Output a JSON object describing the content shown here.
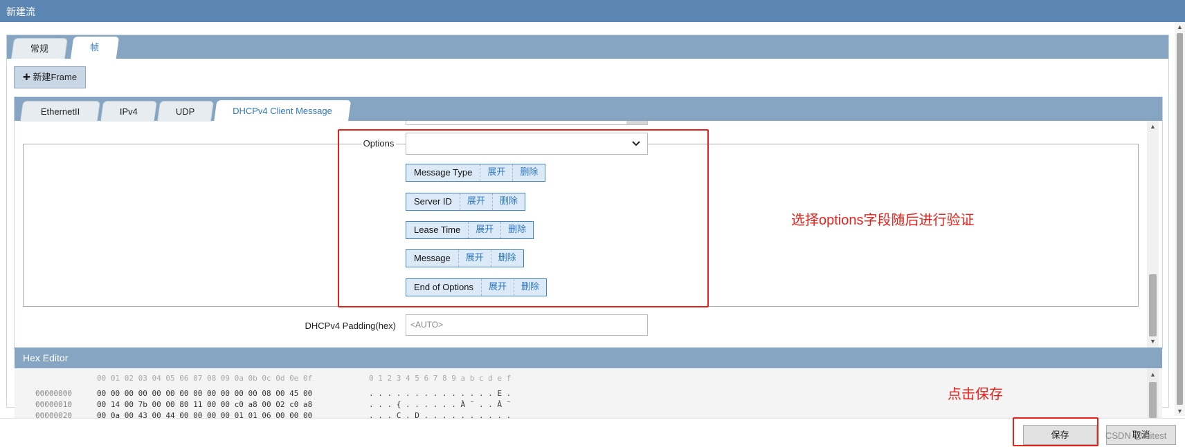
{
  "window": {
    "title": "新建流"
  },
  "top_tabs": [
    {
      "label": "常规",
      "active": false
    },
    {
      "label": "帧",
      "active": true
    }
  ],
  "new_frame_button": {
    "icon": "plus-icon",
    "label": "新建Frame"
  },
  "protocol_tabs": [
    {
      "label": "EthernetII",
      "active": false
    },
    {
      "label": "IPv4",
      "active": false
    },
    {
      "label": "UDP",
      "active": false
    },
    {
      "label": "DHCPv4 Client Message",
      "active": true
    }
  ],
  "options_field": {
    "label": "Options",
    "selected_value": "",
    "items": [
      {
        "name": "Message Type",
        "expand": "展开",
        "delete": "删除"
      },
      {
        "name": "Server ID",
        "expand": "展开",
        "delete": "删除"
      },
      {
        "name": "Lease Time",
        "expand": "展开",
        "delete": "删除"
      },
      {
        "name": "Message",
        "expand": "展开",
        "delete": "删除"
      },
      {
        "name": "End of Options",
        "expand": "展开",
        "delete": "删除"
      }
    ]
  },
  "padding_field": {
    "label": "DHCPv4 Padding(hex)",
    "value": "<AUTO>"
  },
  "hex_editor": {
    "title": "Hex Editor",
    "column_header_hex": "00 01 02 03 04 05 06 07 08 09 0a 0b 0c 0d 0e 0f",
    "column_header_ascii": "0 1 2 3 4 5 6 7 8 9 a b c d e f",
    "rows": [
      {
        "offset": "00000000",
        "hex": "00 00 00 00 00 00 00 00 00 00 00 00 08 00 45 00",
        "ascii": ". . . . . . . . . . . . . . E ."
      },
      {
        "offset": "00000010",
        "hex": "00 14 00 7b 00 00 80 11 00 00 c0 a8 00 02 c0 a8",
        "ascii": ". . . { . . . . . . À ¨ . . À ¨"
      },
      {
        "offset": "00000020",
        "hex": "00 0a 00 43 00 44 00 00 00 00 01 01 06 00 00 00",
        "ascii": ". . . C . D . . . . . . . . . ."
      }
    ]
  },
  "buttons": {
    "save": "保存",
    "cancel": "取消"
  },
  "annotations": {
    "options_note": "选择options字段随后进行验证",
    "save_note": "点击保存"
  },
  "watermark": "CSDN @tuitest",
  "colors": {
    "titlebar": "#5b86b3",
    "tabstrip": "#86a5c3",
    "accent": "#2f78c2",
    "annotation": "#e8201a"
  }
}
